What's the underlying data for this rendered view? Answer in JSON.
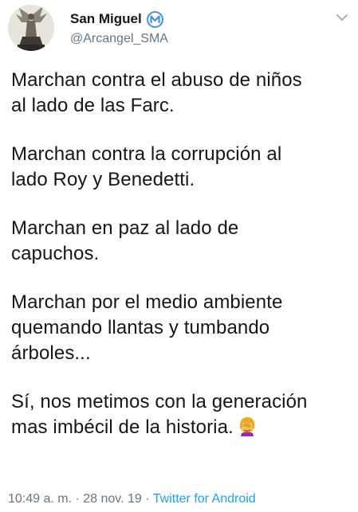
{
  "account": {
    "display_name": "San Miguel",
    "handle": "@Arcangel_SMA",
    "avatar_icon": "archangel-statue-icon",
    "badge_icon": "m-badge-icon",
    "badge_color": "#4a90e2"
  },
  "tweet": {
    "paragraphs": [
      "Marchan contra el abuso de niños\nal lado de las Farc.",
      "Marchan contra la corrupción al\nlado Roy y Benedetti.",
      "Marchan en paz al lado de\ncapuchos.",
      "Marchan por el medio ambiente\nquemando llantas y tumbando\nárboles...",
      "Sí, nos metimos con la generación\nmas imbécil de la historia."
    ],
    "end_emoji": "facepalm-emoji"
  },
  "meta": {
    "time": "10:49 a. m.",
    "separator1": " · ",
    "date": "28 nov. 19",
    "separator2": " · ",
    "source": "Twitter for Android"
  },
  "colors": {
    "text": "#14171a",
    "secondary": "#657786",
    "link": "#1da1f2"
  }
}
